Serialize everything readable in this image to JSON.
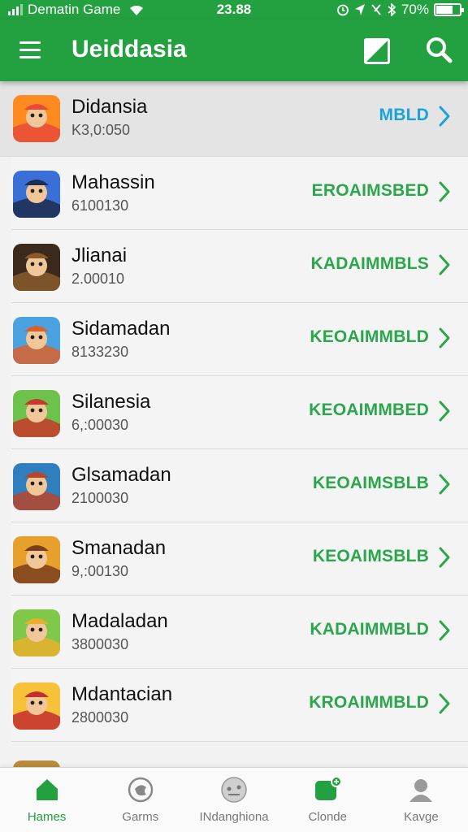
{
  "status_bar": {
    "carrier": "Dematin Game",
    "time": "23.88",
    "battery_text": "70%",
    "battery_level": 0.7
  },
  "app_bar": {
    "title": "Ueiddasia",
    "menu_icon": "hamburger-menu-icon",
    "edit_icon": "edit-square-icon",
    "search_icon": "search-icon"
  },
  "colors": {
    "primary": "#23a040",
    "action_green": "#2aa64b",
    "action_blue": "#1aa3d9",
    "featured_bg": "#e4e4e4"
  },
  "games": [
    {
      "name": "Didansia",
      "count": "K3,0:050",
      "action": "MBLD",
      "action_color": "#1aa3d9",
      "featured": true
    },
    {
      "name": "Mahassin",
      "count": "6100130",
      "action": "EROAIMSBED",
      "action_color": "#2aa64b"
    },
    {
      "name": "Jlianai",
      "count": "2.00010",
      "action": "KADAIMMBLS",
      "action_color": "#2aa64b"
    },
    {
      "name": "Sidamadan",
      "count": "8133230",
      "action": "KEOAIMMBLD",
      "action_color": "#2aa64b"
    },
    {
      "name": "Silanesia",
      "count": "6,:00030",
      "action": "KEOAIMMBED",
      "action_color": "#2aa64b"
    },
    {
      "name": "Glsamadan",
      "count": "2100030",
      "action": "KEOAIMSBLB",
      "action_color": "#2aa64b"
    },
    {
      "name": "Smanadan",
      "count": "9,:00130",
      "action": "KEOAIMSBLB",
      "action_color": "#2aa64b"
    },
    {
      "name": "Madaladan",
      "count": "3800030",
      "action": "KADAIMMBLD",
      "action_color": "#2aa64b"
    },
    {
      "name": "Mdantacian",
      "count": "2800030",
      "action": "KROAIMMBLD",
      "action_color": "#2aa64b"
    }
  ],
  "bottom_nav": [
    {
      "label": "Hames",
      "icon": "home-icon",
      "active": true
    },
    {
      "label": "Garms",
      "icon": "games-icon",
      "active": false
    },
    {
      "label": "INdanghiona",
      "icon": "controller-icon",
      "active": false
    },
    {
      "label": "Clonde",
      "icon": "chat-icon",
      "active": false
    },
    {
      "label": "Kavge",
      "icon": "profile-icon",
      "active": false
    }
  ]
}
